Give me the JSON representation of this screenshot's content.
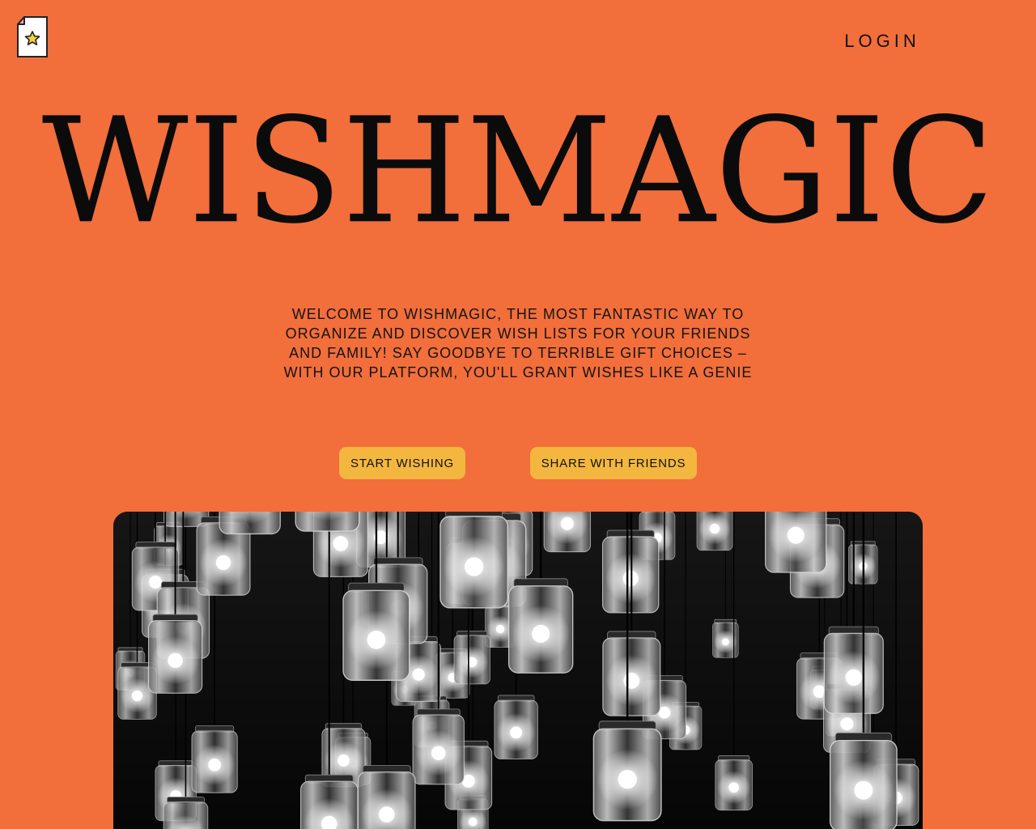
{
  "header": {
    "logo_icon": "wishlist-star-document-icon",
    "login_label": "LOGIN"
  },
  "hero": {
    "title": "WISHMAGIC",
    "tagline": "WELCOME TO WISHMAGIC, THE MOST FANTASTIC WAY TO ORGANIZE AND DISCOVER WISH LISTS FOR YOUR FRIENDS AND FAMILY! SAY GOODBYE TO TERRIBLE GIFT CHOICES – WITH OUR PLATFORM, YOU'LL GRANT WISHES LIKE A GENIE",
    "buttons": {
      "start_label": "START WISHING",
      "share_label": "SHARE WITH FRIENDS"
    },
    "image_subject": "hanging-jar-lightbulbs-photo"
  },
  "colors": {
    "background": "#f26e3b",
    "button": "#f3b73f",
    "text": "#111111"
  }
}
